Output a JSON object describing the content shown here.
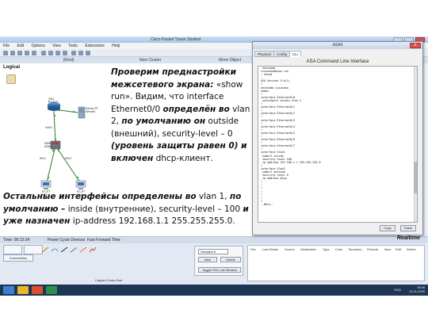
{
  "pt_window": {
    "title": "Cisco Packet Tracer Student",
    "menu": [
      "File",
      "Edit",
      "Options",
      "View",
      "Tools",
      "Extensions",
      "Help"
    ],
    "nav": {
      "root": "[Root]",
      "cluster": "New Cluster",
      "viewport": "Move Object"
    },
    "workspace_tab": "Logical"
  },
  "topology": {
    "server_label": "Server-PT\nServer0",
    "router_label": "2911\nRouter0",
    "asa_label": "5505\nASA0",
    "pc_left_label": "PC-PT\nPC0",
    "pc_right_label": "PC-PT\nPC1",
    "port_labels": {
      "e00": "Fa0/0",
      "e01": "Et0/1",
      "e02": "Et0/2"
    },
    "colors": {
      "link": "#2b7a2b",
      "router": "#2f6fb0",
      "asa": "#555e6b",
      "pc": "#6d7d95",
      "server": "#8fa4c2"
    }
  },
  "bottom_panel": {
    "realtime_label": "Realtime",
    "time_info": "Time: 00:13:34",
    "power_cycle": "Power Cycle Devices",
    "fast_forward": "Fast Forward Time",
    "connections_label": "Connections",
    "scenario_value": "Scenario 0",
    "new_button": "New",
    "delete_button": "Delete",
    "toggle_pdu": "Toggle PDU List Window",
    "pdu_columns": [
      "Fire",
      "Last Status",
      "Source",
      "Destination",
      "Type",
      "Color",
      "Time(sec)",
      "Periodic",
      "Num",
      "Edit",
      "Delete"
    ],
    "cable_label": "Copper Cross-Over"
  },
  "asa_dialog": {
    "title": "ASA0",
    "tabs": [
      "Physical",
      "Config",
      "CLI"
    ],
    "active_tab": "CLI",
    "heading": "ASA Command Line Interface",
    "copy_button": "Copy",
    "paste_button": "Paste",
    "cli_lines": [
      " hostname",
      "ciscoasa#show run",
      ": Saved",
      ":",
      "ASA Version 9.6(1)",
      "!",
      "hostname ciscoasa",
      "names",
      "!",
      "interface Ethernet0/0",
      " switchport access vlan 2",
      "!",
      "interface Ethernet0/1",
      "!",
      "interface Ethernet0/2",
      "!",
      "interface Ethernet0/3",
      "!",
      "interface Ethernet0/4",
      "!",
      "interface Ethernet0/5",
      "!",
      "interface Ethernet0/6",
      "!",
      "interface Ethernet0/7",
      "!",
      "interface Vlan1",
      " nameif inside",
      " security-level 100",
      " ip address 192.168.1.1 255.255.255.0",
      "!",
      "interface Vlan2",
      " nameif outside",
      " security-level 0",
      " ip address dhcp",
      "!",
      "!",
      "!",
      "!",
      "!",
      "!",
      "!",
      "--More--"
    ]
  },
  "taskbar": {
    "lang": "ENG",
    "time": "19:46",
    "date": "11.01.2020"
  },
  "note_top": {
    "p1": "Проверим преднастройки межсетевого экрана:",
    "p2": "«show run». Видим, что interface Ethernet0/0",
    "p3": "определён во",
    "p4": "vlan 2,",
    "p5": "по умолчанию он",
    "p6": "outside (внешний),",
    "p7": "security-level – 0",
    "p8": "(уровень защиты равен 0) и включен",
    "p9": "dhcp-клиент."
  },
  "note_bottom": {
    "p1": "Остальные интерфейсы определены во",
    "p2": "vlan 1,",
    "p3": "по умолчанию –",
    "p4": "inside (внутренние),",
    "p5": "security-level – 100",
    "p6": "и уже назначен",
    "p7": "ip-address 192.168.1.1 255.255.255.0."
  }
}
